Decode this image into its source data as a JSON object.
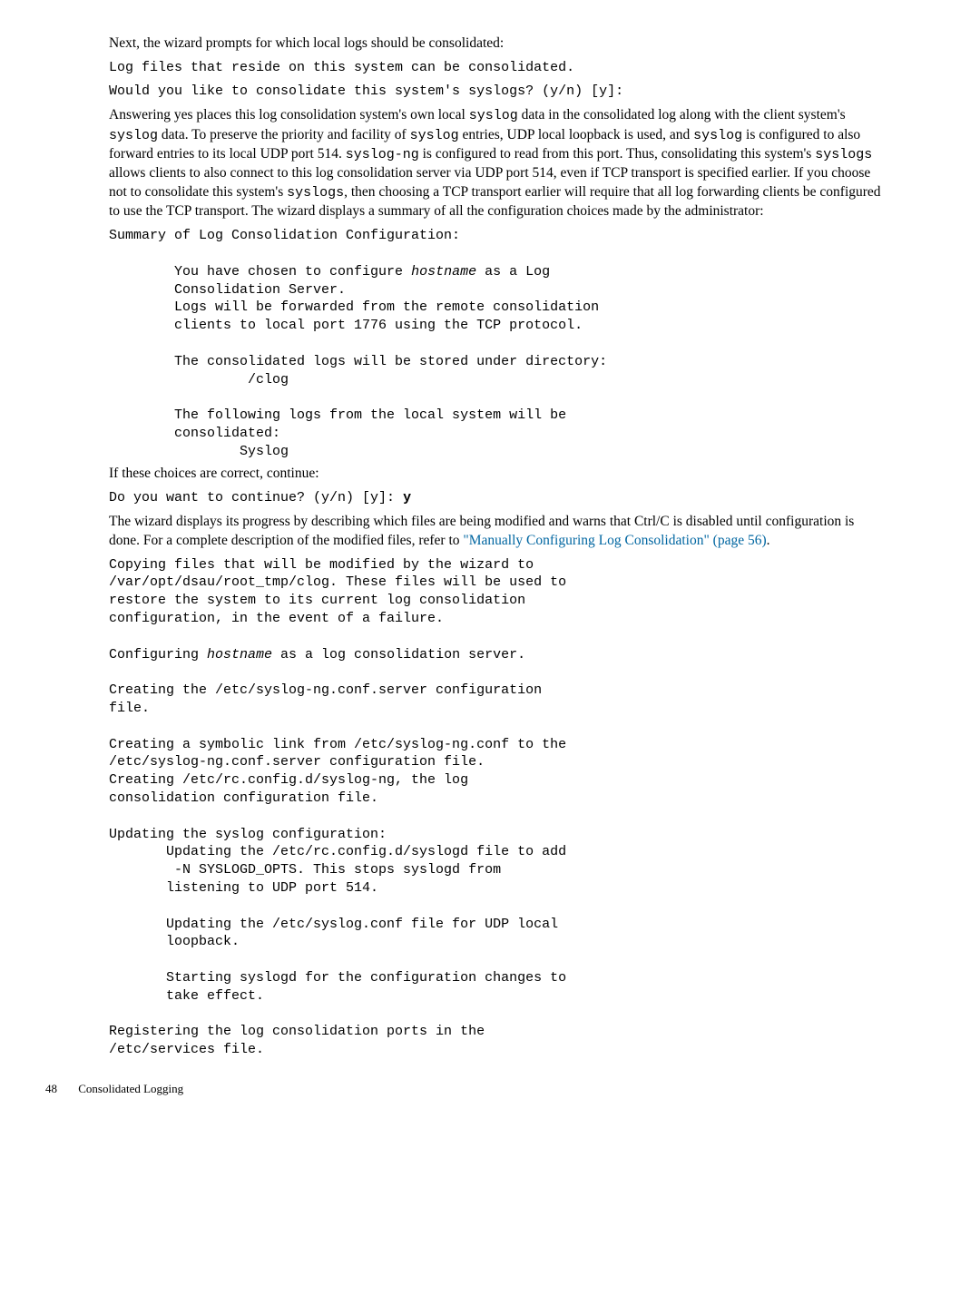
{
  "para1": "Next, the wizard prompts for which local logs should be consolidated:",
  "mono1": "Log files that reside on this system can be consolidated.",
  "mono2": "Would you like to consolidate this system's syslogs? (y/n) [y]:",
  "para2_a": "Answering yes places this log consolidation system's own local ",
  "para2_b": " data in the consolidated log along with the client system's ",
  "para2_c": " data. To preserve the priority and facility of ",
  "para2_d": " entries, UDP local loopback is used, and ",
  "para2_e": " is configured to also forward entries to its local UDP port 514. ",
  "para2_f": " is configured to read from this port. Thus, consolidating this system's ",
  "para2_g": " allows clients to also connect to this log consolidation server via UDP port 514, even if TCP transport is specified earlier. If you choose not to consolidate this system's ",
  "para2_h": ", then choosing a TCP transport earlier will require that all log forwarding clients be configured to use the TCP transport. The wizard displays a summary of all the configuration choices made by the administrator:",
  "inline_syslog": "syslog",
  "inline_syslog_ng": "syslog-ng",
  "inline_syslogs": "syslogs",
  "mono3_l1": "Summary of Log Consolidation Configuration:",
  "mono3_l2a": "        You have chosen to configure ",
  "mono3_hostname": "hostname",
  "mono3_l2b": " as a Log",
  "mono3_l3": "        Consolidation Server.",
  "mono3_l4": "        Logs will be forwarded from the remote consolidation",
  "mono3_l5": "        clients to local port 1776 using the TCP protocol.",
  "mono3_l6": "        The consolidated logs will be stored under directory:",
  "mono3_l7": "                 /clog",
  "mono3_l8": "        The following logs from the local system will be",
  "mono3_l9": "        consolidated:",
  "mono3_l10": "                Syslog",
  "para3": "If these choices are correct, continue:",
  "mono4_a": "Do you want to continue? (y/n) [y]: ",
  "mono4_b": "y",
  "para5_a": "The wizard displays its progress by describing which files are being modified and warns that Ctrl/C is disabled until configuration is done. For a complete description of the modified files, refer to ",
  "link_text": "\"Manually Configuring Log Consolidation\" (page 56)",
  "para5_b": ".",
  "pre_block1": "Copying files that will be modified by the wizard to\n/var/opt/dsau/root_tmp/clog. These files will be used to\nrestore the system to its current log consolidation\nconfiguration, in the event of a failure.\n\nConfiguring ",
  "pre_block1_host": "hostname",
  "pre_block1_tail": " as a log consolidation server.\n\nCreating the /etc/syslog-ng.conf.server configuration\nfile.\n\nCreating a symbolic link from /etc/syslog-ng.conf to the\n/etc/syslog-ng.conf.server configuration file.\nCreating /etc/rc.config.d/syslog-ng, the log\nconsolidation configuration file.\n\nUpdating the syslog configuration:\n       Updating the /etc/rc.config.d/syslogd file to add\n        -N SYSLOGD_OPTS. This stops syslogd from\n       listening to UDP port 514.\n\n       Updating the /etc/syslog.conf file for UDP local\n       loopback.\n\n       Starting syslogd for the configuration changes to\n       take effect.\n\nRegistering the log consolidation ports in the\n/etc/services file.",
  "footer_page": "48",
  "footer_title": "Consolidated Logging"
}
